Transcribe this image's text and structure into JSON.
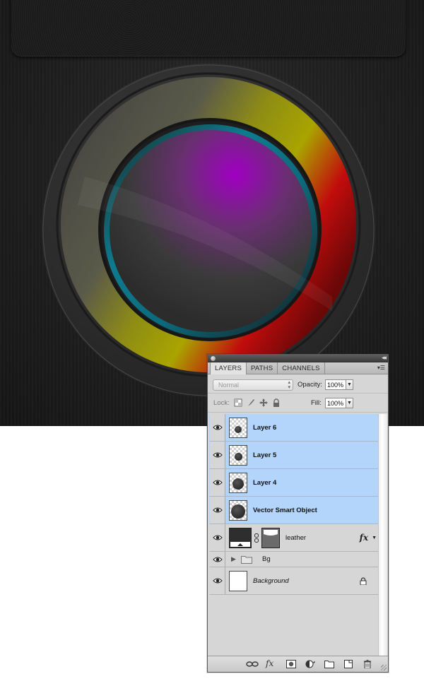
{
  "panel": {
    "tabs": [
      {
        "label": "LAYERS",
        "active": true
      },
      {
        "label": "PATHS",
        "active": false
      },
      {
        "label": "CHANNELS",
        "active": false
      }
    ],
    "blend_mode": "Normal",
    "opacity_label": "Opacity:",
    "opacity_value": "100%",
    "lock_label": "Lock:",
    "fill_label": "Fill:",
    "fill_value": "100%",
    "layers": [
      {
        "name": "Layer 6",
        "selected": true,
        "visible": true
      },
      {
        "name": "Layer 5",
        "selected": true,
        "visible": true
      },
      {
        "name": "Layer 4",
        "selected": true,
        "visible": true
      },
      {
        "name": "Vector Smart Object",
        "selected": true,
        "visible": true
      },
      {
        "name": "leather",
        "selected": false,
        "visible": true,
        "has_mask": true,
        "has_fx": true
      },
      {
        "name": "Bg",
        "selected": false,
        "visible": true,
        "is_group": true
      },
      {
        "name": "Background",
        "selected": false,
        "visible": true,
        "locked": true
      }
    ],
    "fx_label": "fx",
    "toolbar_icons": [
      "link-icon",
      "fx-icon",
      "mask-icon",
      "adjustment-icon",
      "folder-icon",
      "new-layer-icon",
      "trash-icon"
    ]
  },
  "colors": {
    "selection": "#b3d4fb",
    "panel_bg": "#d6d6d6",
    "ring_red": "#c00a0a",
    "ring_yellow": "#a8a300",
    "ring_teal": "#0d7a8f",
    "lens_magenta": "#a400c4"
  }
}
